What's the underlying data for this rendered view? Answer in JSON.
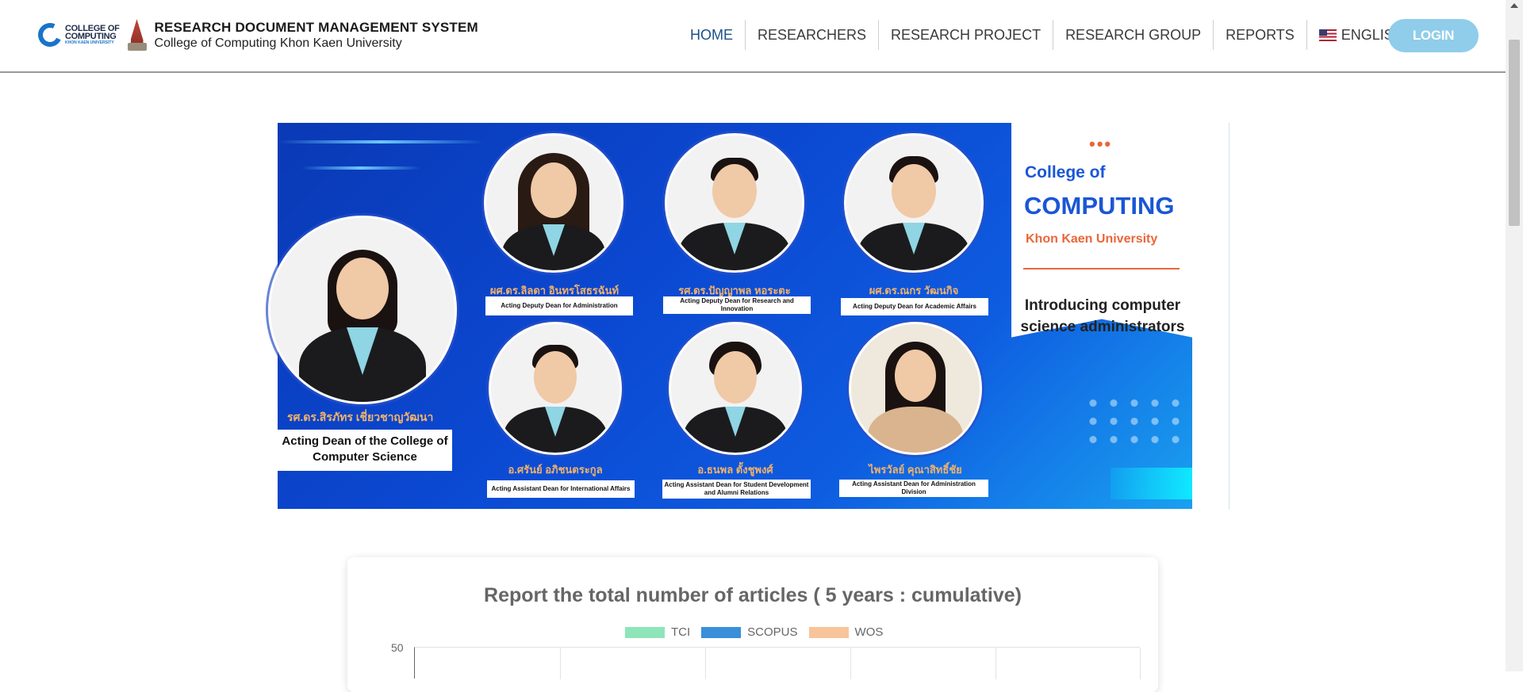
{
  "header": {
    "logo_lines": [
      "COLLEGE OF",
      "COMPUTING",
      "KHON KAEN UNIVERSITY"
    ],
    "title": "RESEARCH DOCUMENT MANAGEMENT SYSTEM",
    "subtitle": "College of Computing Khon Kaen University",
    "nav": [
      {
        "label": "HOME",
        "active": true
      },
      {
        "label": "RESEARCHERS"
      },
      {
        "label": "RESEARCH PROJECT"
      },
      {
        "label": "RESEARCH GROUP"
      },
      {
        "label": "REPORTS"
      }
    ],
    "language": "ENGLISH",
    "login_label": "LOGIN"
  },
  "banner": {
    "panel": {
      "line1": "College of",
      "line2": "COMPUTING",
      "line3": "Khon Kaen University",
      "tagline": "Introducing computer science administrators"
    },
    "dean": {
      "name": "รศ.ดร.สิรภัทร เชี่ยวชาญวัฒนา",
      "role": "Acting Dean of the College of Computer Science"
    },
    "people": [
      {
        "name": "ผศ.ดร.ลิลดา อินทรโสธรฉันท์",
        "role": "Acting Deputy Dean for Administration"
      },
      {
        "name": "รศ.ดร.ปัญญาพล หอระตะ",
        "role": "Acting Deputy Dean for Research and Innovation"
      },
      {
        "name": "ผศ.ดร.ณกร วัฒนกิจ",
        "role": "Acting Deputy Dean for Academic Affairs"
      },
      {
        "name": "อ.ศรันย์ อภิชนตระกูล",
        "role": "Acting Assistant Dean for International Affairs"
      },
      {
        "name": "อ.ธนพล ตั้งชูพงศ์",
        "role": "Acting Assistant Dean for Student Development and Alumni Relations"
      },
      {
        "name": "ไพรวัลย์ คุณาสิทธิ์ชัย",
        "role": "Acting Assistant Dean for Administration Division"
      }
    ]
  },
  "report": {
    "title": "Report the total number of articles ( 5 years : cumulative)",
    "legend": [
      {
        "label": "TCI",
        "color": "#8ee6b8"
      },
      {
        "label": "SCOPUS",
        "color": "#3a8fd9"
      },
      {
        "label": "WOS",
        "color": "#f8c49a"
      }
    ],
    "y_top_tick": "50"
  }
}
